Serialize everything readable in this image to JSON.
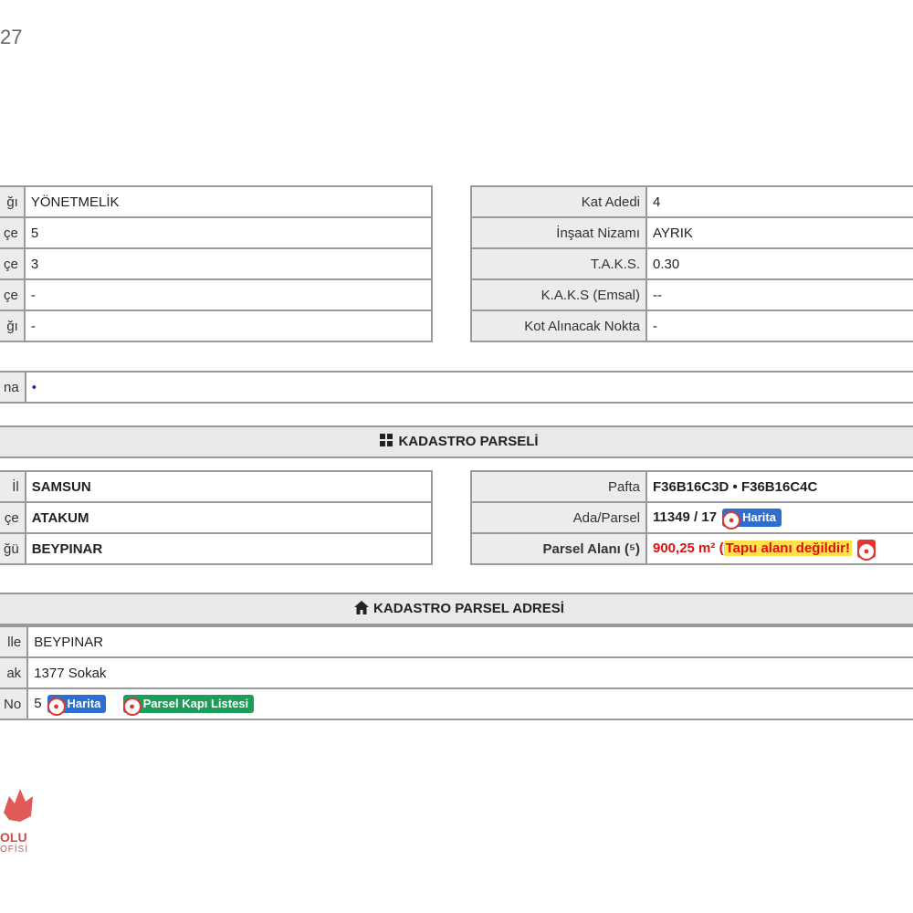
{
  "corner_text": "27",
  "imar_left": [
    {
      "label": "ğı",
      "value": "YÖNETMELİK"
    },
    {
      "label": "çe",
      "value": "5"
    },
    {
      "label": "çe",
      "value": "3"
    },
    {
      "label": "çe",
      "value": "-"
    },
    {
      "label": "ğı",
      "value": "-"
    }
  ],
  "imar_right": [
    {
      "label": "Kat Adedi",
      "value": "4"
    },
    {
      "label": "İnşaat Nizamı",
      "value": "AYRIK"
    },
    {
      "label": "T.A.K.S.",
      "value": "0.30"
    },
    {
      "label": "K.A.K.S (Emsal)",
      "value": "--"
    },
    {
      "label": "Kot Alınacak Nokta",
      "value": "-"
    }
  ],
  "aciklama": {
    "label": "na",
    "value": "•"
  },
  "kadastro_header": "KADASTRO PARSELİ",
  "kadastro_left": [
    {
      "label": "İl",
      "value": "SAMSUN"
    },
    {
      "label": "çe",
      "value": "ATAKUM"
    },
    {
      "label": "ğü",
      "value": "BEYPINAR"
    }
  ],
  "kadastro_right": {
    "pafta_label": "Pafta",
    "pafta_value": "F36B16C3D • F36B16C4C",
    "ada_label": "Ada/Parsel",
    "ada_value": "11349 / 17",
    "harita_badge": "Harita",
    "alan_label": "Parsel Alanı (⁵)",
    "alan_value": "900,25 m²",
    "alan_open": "(",
    "alan_warning": "Tapu alanı değildir!"
  },
  "adres_header": "KADASTRO PARSEL ADRESİ",
  "adres": {
    "mahalle_label": "lle",
    "mahalle_value": "BEYPINAR",
    "sokak_label": "ak",
    "sokak_value": "1377 Sokak",
    "no_label": "No",
    "no_value": "5",
    "harita_badge": "Harita",
    "kapi_badge": "Parsel Kapı Listesi"
  },
  "logo": {
    "text1": "OLU",
    "text2": "OFİSİ"
  },
  "colors": {
    "blue_badge": "#2d6fd1",
    "green_badge": "#1c9e5a",
    "warning_bg": "#ffe14a",
    "alert_red": "#dd1111"
  }
}
